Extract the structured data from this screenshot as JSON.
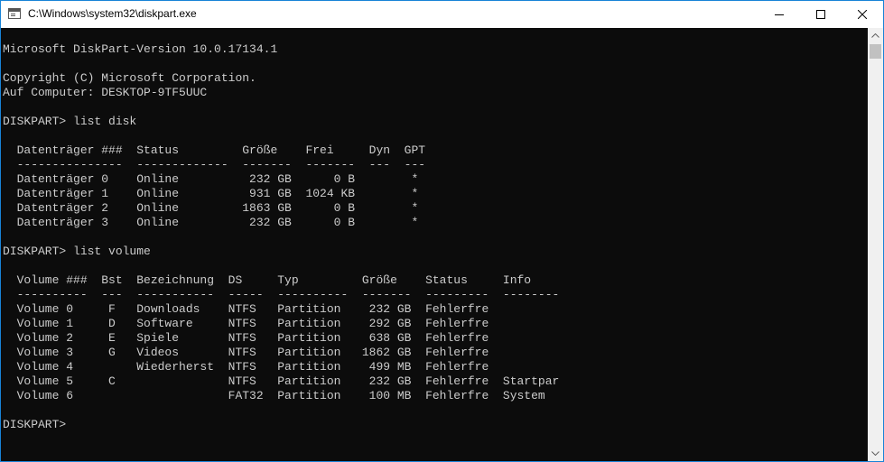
{
  "window": {
    "title": "C:\\Windows\\system32\\diskpart.exe"
  },
  "console": {
    "lines": [
      "",
      "Microsoft DiskPart-Version 10.0.17134.1",
      "",
      "Copyright (C) Microsoft Corporation.",
      "Auf Computer: DESKTOP-9TF5UUC",
      "",
      "DISKPART> list disk",
      "",
      "  Datenträger ###  Status         Größe    Frei     Dyn  GPT",
      "  ---------------  -------------  -------  -------  ---  ---",
      "  Datenträger 0    Online          232 GB      0 B        *",
      "  Datenträger 1    Online          931 GB  1024 KB        *",
      "  Datenträger 2    Online         1863 GB      0 B        *",
      "  Datenträger 3    Online          232 GB      0 B        *",
      "",
      "DISKPART> list volume",
      "",
      "  Volume ###  Bst  Bezeichnung  DS     Typ         Größe    Status     Info",
      "  ----------  ---  -----------  -----  ----------  -------  ---------  --------",
      "  Volume 0     F   Downloads    NTFS   Partition    232 GB  Fehlerfre",
      "  Volume 1     D   Software     NTFS   Partition    292 GB  Fehlerfre",
      "  Volume 2     E   Spiele       NTFS   Partition    638 GB  Fehlerfre",
      "  Volume 3     G   Videos       NTFS   Partition   1862 GB  Fehlerfre",
      "  Volume 4         Wiederherst  NTFS   Partition    499 MB  Fehlerfre",
      "  Volume 5     C                NTFS   Partition    232 GB  Fehlerfre  Startpar",
      "  Volume 6                      FAT32  Partition    100 MB  Fehlerfre  System",
      "",
      "DISKPART>"
    ]
  }
}
